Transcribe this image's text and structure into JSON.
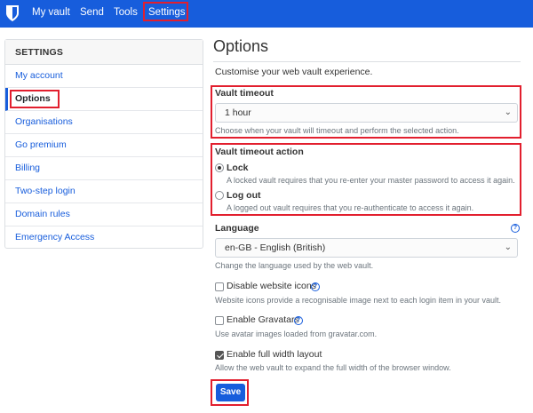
{
  "topnav": {
    "logo_icon": "shield-icon",
    "items": [
      {
        "label": "My vault"
      },
      {
        "label": "Send"
      },
      {
        "label": "Tools"
      },
      {
        "label": "Settings"
      }
    ],
    "brand_color": "#175ddc"
  },
  "sidebar": {
    "header": "SETTINGS",
    "items": [
      {
        "label": "My account"
      },
      {
        "label": "Options"
      },
      {
        "label": "Organisations"
      },
      {
        "label": "Go premium"
      },
      {
        "label": "Billing"
      },
      {
        "label": "Two-step login"
      },
      {
        "label": "Domain rules"
      },
      {
        "label": "Emergency Access"
      }
    ],
    "active_item": "Options"
  },
  "main": {
    "title": "Options",
    "subtitle": "Customise your web vault experience.",
    "vault_timeout": {
      "label": "Vault timeout",
      "value": "1 hour",
      "help": "Choose when your vault will timeout and perform the selected action."
    },
    "vault_timeout_action": {
      "label": "Vault timeout action",
      "options": [
        {
          "label": "Lock",
          "help": "A locked vault requires that you re-enter your master password to access it again.",
          "checked": true
        },
        {
          "label": "Log out",
          "help": "A logged out vault requires that you re-authenticate to access it again.",
          "checked": false
        }
      ]
    },
    "language": {
      "label": "Language",
      "value": "en-GB - English (British)",
      "help": "Change the language used by the web vault."
    },
    "disable_icons": {
      "label": "Disable website icons",
      "checked": false,
      "help": "Website icons provide a recognisable image next to each login item in your vault."
    },
    "gravatars": {
      "label": "Enable Gravatars",
      "checked": false,
      "help": "Use avatar images loaded from gravatar.com."
    },
    "full_width": {
      "label": "Enable full width layout",
      "checked": true,
      "help": "Allow the web vault to expand the full width of the browser window."
    },
    "help_icon_glyph": "?",
    "select_chevron": "⌄",
    "save_label": "Save"
  },
  "highlight_color": "#e21f2e"
}
